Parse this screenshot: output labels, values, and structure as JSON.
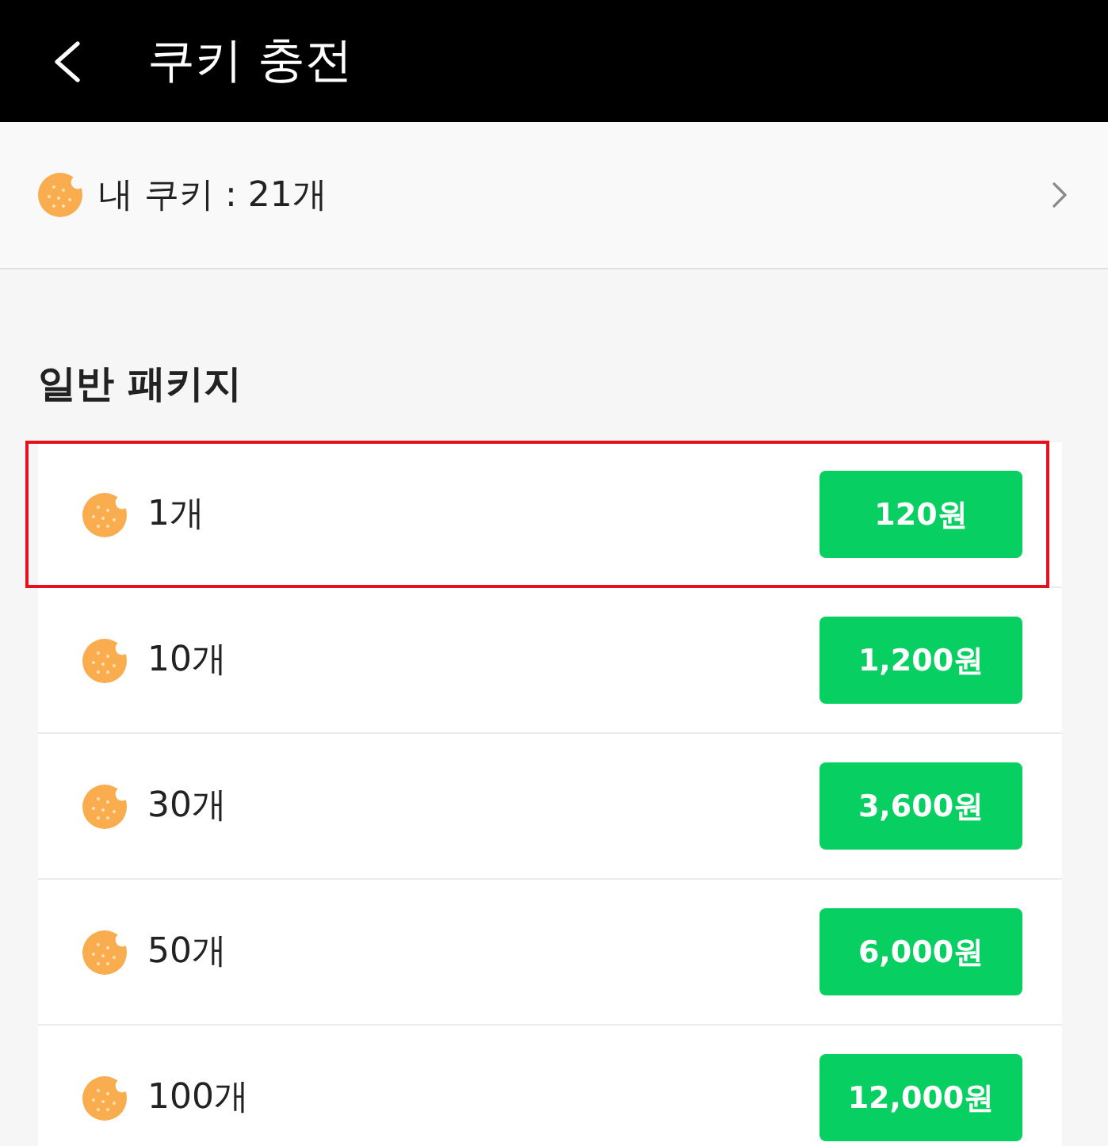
{
  "header": {
    "title": "쿠키 충전"
  },
  "balance": {
    "label": "내 쿠키 : 21개"
  },
  "section": {
    "title": "일반 패키지",
    "packages": [
      {
        "amount": "1개",
        "price": "120원",
        "highlighted": true
      },
      {
        "amount": "10개",
        "price": "1,200원",
        "highlighted": false
      },
      {
        "amount": "30개",
        "price": "3,600원",
        "highlighted": false
      },
      {
        "amount": "50개",
        "price": "6,000원",
        "highlighted": false
      },
      {
        "amount": "100개",
        "price": "12,000원",
        "highlighted": false
      }
    ]
  }
}
